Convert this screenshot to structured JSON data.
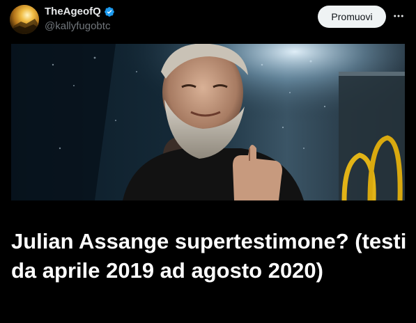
{
  "post": {
    "author": {
      "display_name": "TheAgeofQ",
      "handle": "@kallyfugobtc",
      "verified": true,
      "verified_icon": "verified-badge-icon",
      "verified_color": "#1d9bf0"
    },
    "promote_label": "Promuovi",
    "more_icon": "more-options-icon",
    "media": {
      "type": "photo",
      "icon": "photo-image"
    },
    "headline": "Julian Assange supertestimone? (testi da aprile 2019 ad agosto 2020)"
  },
  "colors": {
    "background": "#000000",
    "text_primary": "#e7e9ea",
    "text_secondary": "#71767b",
    "button_bg": "#eff3f4",
    "button_text": "#0f1419"
  }
}
